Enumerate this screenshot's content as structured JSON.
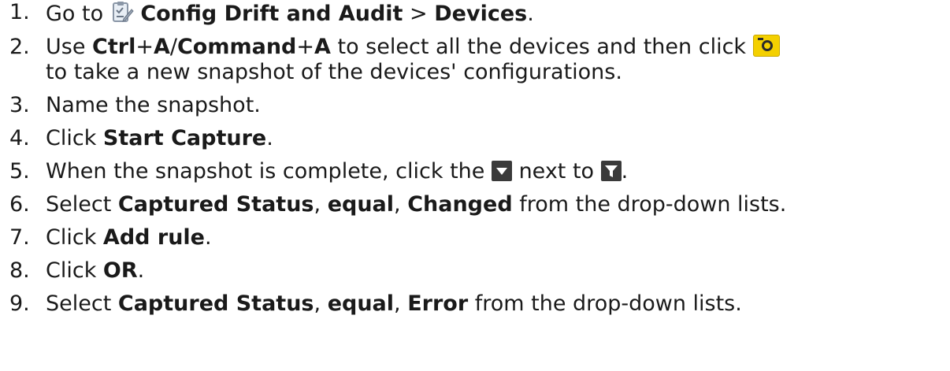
{
  "steps": [
    {
      "n": "1.",
      "t1": "Go to ",
      "b1": "Config Drift and Audit",
      "t2": " > ",
      "b2": "Devices",
      "t3": "."
    },
    {
      "n": "2.",
      "t1": "Use ",
      "b1": "Ctrl",
      "t2": "+",
      "b2": "A",
      "t3": "/",
      "b3": "Command",
      "t4": "+",
      "b4": "A",
      "t5": " to select all the devices and then click ",
      "line2": "to take a new snapshot of the devices' configurations."
    },
    {
      "n": "3.",
      "t1": "Name the snapshot."
    },
    {
      "n": "4.",
      "t1": "Click ",
      "b1": "Start Capture",
      "t2": "."
    },
    {
      "n": "5.",
      "t1": "When the snapshot is complete, click the ",
      "t2": " next to ",
      "t3": "."
    },
    {
      "n": "6.",
      "t1": "Select ",
      "b1": "Captured Status",
      "t2": ", ",
      "b2": "equal",
      "t3": ", ",
      "b3": "Changed",
      "t4": " from the drop-down lists."
    },
    {
      "n": "7.",
      "t1": "Click ",
      "b1": "Add rule",
      "t2": "."
    },
    {
      "n": "8.",
      "t1": "Click ",
      "b1": "OR",
      "t2": "."
    },
    {
      "n": "9.",
      "t1": "Select ",
      "b1": "Captured Status",
      "t2": ", ",
      "b2": "equal",
      "t3": ", ",
      "b3": "Error",
      "t4": " from the drop-down lists."
    }
  ],
  "icons": {
    "config_drift": "clipboard-checklist-icon",
    "snapshot": "camera-icon",
    "dropdown": "triangle-down-icon",
    "filter": "filter-funnel-icon"
  }
}
